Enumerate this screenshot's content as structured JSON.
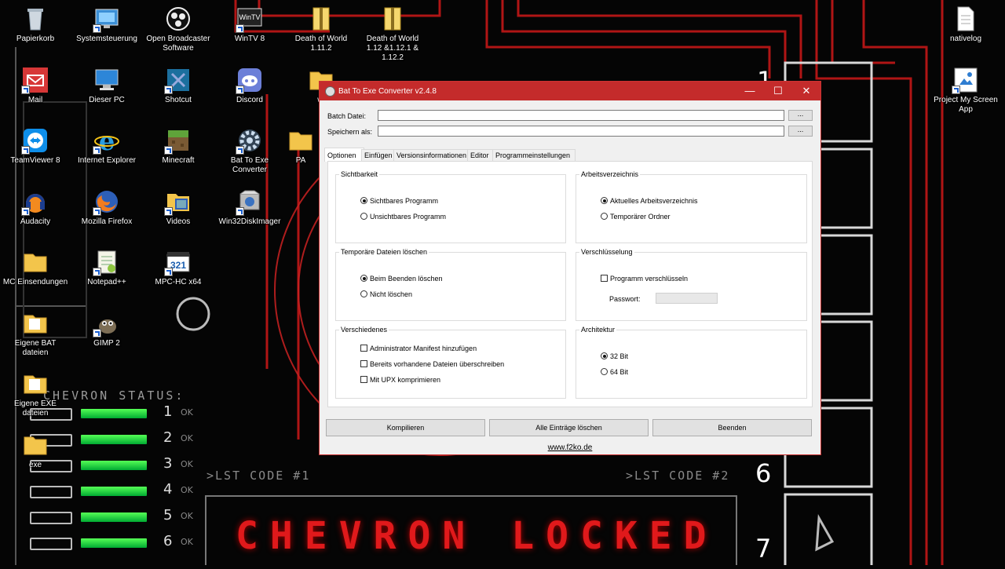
{
  "desktop": {
    "icons": [
      {
        "label": "Papierkorb",
        "icon": "recycle-bin-icon"
      },
      {
        "label": "Systemsteuerung",
        "icon": "control-panel-icon"
      },
      {
        "label": "Open Broadcaster Software",
        "icon": "obs-icon"
      },
      {
        "label": "WinTV 8",
        "icon": "wintv-icon"
      },
      {
        "label": "Death of World 1.11.2",
        "icon": "archive-icon"
      },
      {
        "label": "Death of World 1.12 &1.12.1 & 1.12.2",
        "icon": "archive-icon"
      },
      {
        "label": "nativelog",
        "icon": "text-file-icon"
      },
      {
        "label": "Mail",
        "icon": "mail-icon"
      },
      {
        "label": "Dieser PC",
        "icon": "computer-icon"
      },
      {
        "label": "Shotcut",
        "icon": "shotcut-icon"
      },
      {
        "label": "Discord",
        "icon": "discord-icon"
      },
      {
        "label": "Project My Screen App",
        "icon": "project-screen-icon"
      },
      {
        "label": "TeamViewer 8",
        "icon": "teamviewer-icon"
      },
      {
        "label": "Internet Explorer",
        "icon": "internet-explorer-icon"
      },
      {
        "label": "Minecraft",
        "icon": "minecraft-icon"
      },
      {
        "label": "Bat To Exe Converter",
        "icon": "gear-icon"
      },
      {
        "label": "Audacity",
        "icon": "audacity-icon"
      },
      {
        "label": "Mozilla Firefox",
        "icon": "firefox-icon"
      },
      {
        "label": "Videos",
        "icon": "video-folder-icon"
      },
      {
        "label": "Win32DiskImager",
        "icon": "disk-imager-icon"
      },
      {
        "label": "MC Einsendungen",
        "icon": "folder-icon"
      },
      {
        "label": "Notepad++",
        "icon": "notepad-icon"
      },
      {
        "label": "MPC-HC x64",
        "icon": "mpc-icon"
      },
      {
        "label": "Eigene BAT dateien",
        "icon": "folder-icon"
      },
      {
        "label": "GIMP 2",
        "icon": "gimp-icon"
      },
      {
        "label": "Eigene EXE dateien",
        "icon": "folder-icon"
      },
      {
        "label": "exe",
        "icon": "folder-icon"
      },
      {
        "label": "wi",
        "icon": "folder-icon"
      },
      {
        "label": "PA",
        "icon": "folder-icon"
      }
    ]
  },
  "wallpaper": {
    "status_title": "CHEVRON STATUS:",
    "status_rows": [
      {
        "num": "1",
        "ok": "OK"
      },
      {
        "num": "2",
        "ok": "OK"
      },
      {
        "num": "3",
        "ok": "OK"
      },
      {
        "num": "4",
        "ok": "OK"
      },
      {
        "num": "5",
        "ok": "OK"
      },
      {
        "num": "6",
        "ok": "OK"
      }
    ],
    "lst_code_1": ">LST CODE #1",
    "lst_code_2": ">LST CODE #2",
    "chevron_locked": "CHEVRON LOCKED",
    "side_numbers": [
      "1",
      "6",
      "7"
    ]
  },
  "window": {
    "title": "Bat To Exe Converter v2.4.8",
    "controls": {
      "minimize": "—",
      "maximize": "☐",
      "close": "✕"
    },
    "batch_label": "Batch Datei:",
    "batch_value": "",
    "save_label": "Speichern als:",
    "save_value": "",
    "browse_label": "...",
    "tabs": [
      "Optionen",
      "Einfügen",
      "Versionsinformationen",
      "Editor",
      "Programmeinstellungen"
    ],
    "active_tab": "Optionen",
    "groups": {
      "visibility": {
        "title": "Sichtbarkeit",
        "options": [
          "Sichtbares Programm",
          "Unsichtbares Programm"
        ],
        "selected": "Sichtbares Programm"
      },
      "workdir": {
        "title": "Arbeitsverzeichnis",
        "options": [
          "Aktuelles Arbeitsverzeichnis",
          "Temporärer Ordner"
        ],
        "selected": "Aktuelles Arbeitsverzeichnis"
      },
      "tempdelete": {
        "title": "Temporäre Dateien löschen",
        "options": [
          "Beim Beenden löschen",
          "Nicht löschen"
        ],
        "selected": "Beim Beenden löschen"
      },
      "encryption": {
        "title": "Verschlüsselung",
        "checkbox": "Programm verschlüsseln",
        "checked": false,
        "password_label": "Passwort:"
      },
      "misc": {
        "title": "Verschiedenes",
        "checkboxes": [
          "Administrator Manifest hinzufügen",
          "Bereits vorhandene Dateien überschreiben",
          "Mit UPX komprimieren"
        ]
      },
      "arch": {
        "title": "Architektur",
        "options": [
          "32 Bit",
          "64 Bit"
        ],
        "selected": "32 Bit"
      }
    },
    "buttons": {
      "compile": "Kompilieren",
      "clear": "Alle Einträge löschen",
      "exit": "Beenden"
    },
    "footer_link": "www.f2ko.de"
  },
  "colors": {
    "titlebar": "#c42b2b",
    "wallpaper_red": "#e0191b",
    "status_green": "#33dd55"
  }
}
